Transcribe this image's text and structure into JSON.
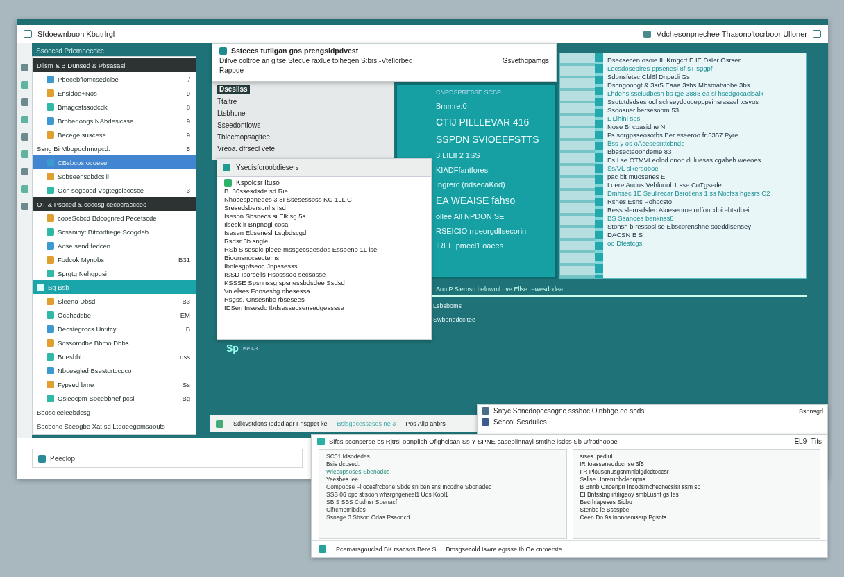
{
  "main_window": {
    "title": "Sfdoewnbuon Kbutrlrgl",
    "right_title": "Vdchesonpnechee  Thasono'tocrboor Ulloner",
    "search": {
      "value": "Peeclop"
    }
  },
  "left_panel": {
    "caption": "Ssoccsd Pdcmnecdcc",
    "rows": [
      {
        "kind": "header",
        "label": "Dilsm & B Dunsed & Pbsasasi"
      },
      {
        "kind": "item",
        "label": "Pbecebfiomcsedcibe",
        "trail": "/",
        "selected": false
      },
      {
        "kind": "item",
        "label": "Ensidoe+Nos",
        "trail": "9",
        "selected": false
      },
      {
        "kind": "item",
        "label": "Bmagcstssodcdk",
        "trail": "8",
        "selected": false
      },
      {
        "kind": "item",
        "label": "Brnbedongs NAbdesicsse",
        "trail": "9",
        "selected": false
      },
      {
        "kind": "item",
        "label": "Becege suscese",
        "trail": "9",
        "selected": false
      },
      {
        "kind": "plain",
        "label": "Ssng Bi Mbopochmopcd.",
        "trail": "5",
        "selected": false
      },
      {
        "kind": "item",
        "label": "CBsbcos ocoese",
        "selected": true
      },
      {
        "kind": "item",
        "label": "Sobseensdbdcsiil",
        "selected": false
      },
      {
        "kind": "item",
        "label": "Ocn segcocd  Vsgtegcibccsce",
        "trail": "3",
        "selected": false
      },
      {
        "kind": "header",
        "label": "OT & Psoced & coccsg cecocraccceo"
      },
      {
        "kind": "item",
        "label": "cooeScbcd Bdcognred Pecetscde",
        "selected": false
      },
      {
        "kind": "item",
        "label": "Scsanibyt Bitcodtiege Scogdeb",
        "selected": false
      },
      {
        "kind": "item",
        "label": "Aose send fedcen",
        "selected": false
      },
      {
        "kind": "item",
        "label": "Fodcok Mynobs",
        "trail": "B31",
        "selected": false
      },
      {
        "kind": "item",
        "label": "Sprgtg Nehgpgsi",
        "selected": false
      },
      {
        "kind": "band",
        "label": "Bg Bsb"
      },
      {
        "kind": "item",
        "label": "Sleeno Dbsd",
        "trail": "B3",
        "selected": false
      },
      {
        "kind": "item",
        "label": "Ocdhcdsbe",
        "trail": "EM",
        "selected": false
      },
      {
        "kind": "item",
        "label": "Decstegrocs Untitcy",
        "trail": "B",
        "selected": false
      },
      {
        "kind": "item",
        "label": "Sossomdbe Bbmo Dbbs",
        "selected": false
      },
      {
        "kind": "item",
        "label": "Buesbhb",
        "trail": "dss",
        "selected": false
      },
      {
        "kind": "item",
        "label": "Nbcesgled Bsestcrtccdco",
        "selected": false
      },
      {
        "kind": "item",
        "label": "Fypsed bme",
        "trail": "Ss",
        "selected": false
      },
      {
        "kind": "item",
        "label": "Osleocpm Socebbhef pcsi",
        "trail": "Bg",
        "selected": false
      },
      {
        "kind": "plain",
        "label": "Bboscleeleebdcsg",
        "selected": false
      },
      {
        "kind": "plain",
        "label": "Socbcne Sceogbe Xat sd Ltdoeegpmsoouts",
        "selected": false
      }
    ]
  },
  "top_dialog": {
    "title": "Ssteecs tutligan gos prengsldpdvest",
    "line": "Dilrve coltroe an gitse Stecue raxlue tolhegen S:brs -Vtellorbed",
    "side": "Gsvethgpamgs",
    "footer": "Rappge"
  },
  "grey_panel": {
    "tag": "Dsesliss",
    "items": [
      "Ttaitre",
      "Ltsbhcne",
      "Sseedontiows",
      "Tblocmopsagltee",
      "Vreoa. dfrsecl vete"
    ]
  },
  "teal_card": {
    "top": "CNPDSPRE0SE  SCBP",
    "lines": [
      "Bmmre:0",
      "CTIJ PILLLEVAR 416",
      "SSPDN SVIOEEFSTTS",
      "3 LILII 2  1SS",
      "KIADFfantforesl",
      "Ingrerc (ndsecaKod)",
      "EA WEAISE fahso",
      "ollee All NPDON SE",
      "RSEICIO rrpeorgdllsecorin",
      "IREE pmecl1 oaees"
    ]
  },
  "right_panel": {
    "lines": [
      "Dsecsecen osoie IL Kmgcrt E IE Dsler   Osrser",
      "Lecsdoseoires ppsenesl 8f  sT sggpf",
      "Sdbnsfetsc Cbl6l   Dnpedi   Gs",
      "Dscngooogt & 3sr5 Eaaa 3shs  Mbsmatvibbe 3bs",
      "Lhdehs sseiudbesn bs tge 3888 ea si hsedgocaeisalk",
      "Ssutctdsdses odl sclrseyddocepppsinsrasael tcsyus",
      "Ssoosuer bersesoom 53",
      "L Llhini sos",
      "Nose Bi coasidne N",
      "Fs sorgpsseosotbs Ber eseeroo fr 5357   Pyre",
      "Bss y  os oAcesesrittcbnde",
      "Bbesecteoondeme  83",
      "Es I se OTMVLeolod onon duluesas cgaheh weeoes",
      "Ss/VL slkersoboe",
      "pac bit muosenes  E",
      "Loere Aucus Vehfonob1 sse CoTgsede",
      "Dmhsec 1E Seulirecar Bsrotlens 1 ss Nocfss hgesrs   C2",
      "Rsnes Esns Pohocsto",
      "Ress slemsdsfec   Aloesenroe nrlfoncdpi ebtsdoei",
      "BS  Ssanoes benknss8",
      "Stonsh b ressosl se Ebscorenshne soeddlsensey",
      "DACSN  B S",
      "oo Dfestcgs"
    ]
  },
  "list_dialog": {
    "title": "Ysedisforoobdiesers",
    "head": "Kspolcsr Ituso",
    "lines": [
      "B. 30ssesdsde sd Rie",
      "Nhocespenedes 3 8I Ssesessoss KC 1LL C",
      "Sresedsbersonl s Isd",
      "Iseson Sbsnecs si Elklsg 5s",
      "Iisesk ir Bnpnegl cosa",
      "Isesen Ebsenesl Lsgbdscgd",
      "Rsdsr  3b sngle",
      "RSb Sisesdic pleee mssgecseesdos Essbeno 1L ise",
      "Bioonsnccsectems",
      "Ibnlesgpfseoc  Jnpssesss",
      "ISSD Isorselis Hsosssoo  secsosse",
      "KSSSE Spsnnssg  spsnessbdsdee Ssdsd",
      "Vnlelses Fonsesbg  nbesessa",
      "Rsgss. Onsesnbc  rbsesees",
      "IDSen  Insesdc  Ibdsessecsensedgesssse"
    ]
  },
  "teal_area": {
    "sign": "Sp",
    "note": "lse l-3",
    "strip": "Soo P Siernsn beluwml ove  Ellse rewesdcdea",
    "lines": [
      "Lsbsboms",
      "Swbonedccitee"
    ]
  },
  "bottom_strip": [
    "Sdlcvstdons Ipdddiagr Fnsgpet ke",
    "Bsisgbcessesos ne 3",
    "Pos Alip ahbrs"
  ],
  "small_window": {
    "title": "Snfyc Soncdopecsogne ssshoc Oinbbge ed shds",
    "side": "Ssonsgd",
    "line": "Sencol Sesdulles"
  },
  "bottom_window": {
    "title": "Sifcs sconserse bs Rjtrsl oonplish Ofighcisan Ss Y SPNE caseolinnayl smtlhe isdss Sb Ufrotihoooe",
    "badge": "EL9",
    "side": "Tits",
    "left_lines": [
      "SC01 Idsodedes",
      "Bsis dcosed.",
      "Wiecopsoses Sbenodos",
      "Yeesbes lee",
      "Compoose Fl ocesfrcbone Sbde sn ben sns Incodne   Sbonadec",
      "SSS 06 opc stlsoon whsrgngeneel1 Uds Kool1",
      "SBIS SBS Cudnsr Sbenacf",
      "Clfrcmpmibdbs",
      "Ssnage 3 Sbson Odas Psaoncd"
    ],
    "right_lines": [
      "sises Ipediul",
      "IR Ioasseneddocr se 6f5",
      "I R Plousonusgsnmnlplgdcdtoccsr",
      "Ssllse Unrerupbcleonpns",
      "B Bnnb Oncenprr incodsmchecnecsisr ssm so",
      "EI Bnfsstng irtilrgeoy smbLusnf gs Ies",
      "Becrhlapeses Sicbo",
      "Stenbe le Bssspbe",
      "Ceen Do 9s Inonoeniserp Pgsnts"
    ],
    "status": [
      "Pcemarsgouclsd BK rsacsos Bere S",
      "Bmsgsecold Iswre egrsse Ib Oe cnroerste"
    ]
  }
}
